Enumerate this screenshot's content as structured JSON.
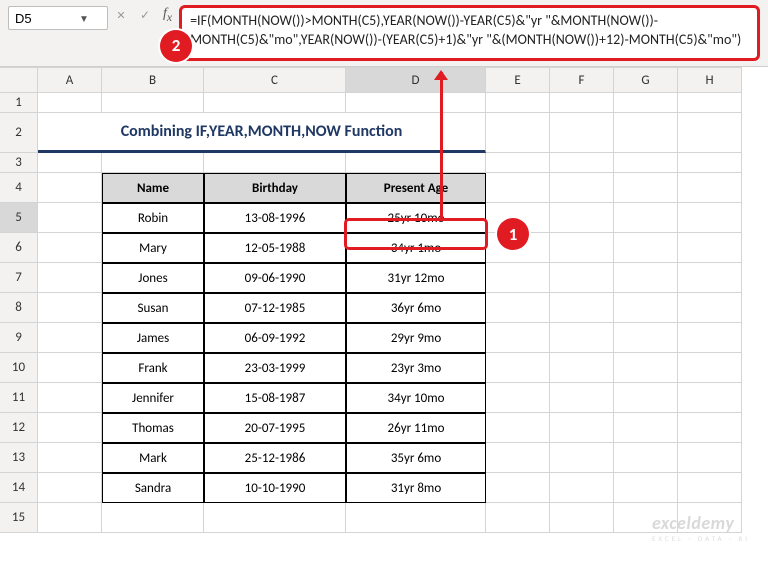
{
  "namebox": {
    "value": "D5"
  },
  "formula": "=IF(MONTH(NOW())>MONTH(C5),YEAR(NOW())-YEAR(C5)&\"yr \"&MONTH(NOW())-MONTH(C5)&\"mo\",YEAR(NOW())-(YEAR(C5)+1)&\"yr \"&(MONTH(NOW())+12)-MONTH(C5)&\"mo\")",
  "columns": [
    "A",
    "B",
    "C",
    "D",
    "E",
    "F",
    "G",
    "H"
  ],
  "rows": [
    "1",
    "2",
    "3",
    "4",
    "5",
    "6",
    "7",
    "8",
    "9",
    "10",
    "11",
    "12",
    "13",
    "14",
    "15"
  ],
  "title": "Combining IF,YEAR,MONTH,NOW Function",
  "headers": {
    "name": "Name",
    "birthday": "Birthday",
    "age": "Present Age"
  },
  "badges": {
    "one": "1",
    "two": "2"
  },
  "data": [
    {
      "name": "Robin",
      "birthday": "13-08-1996",
      "age": "25yr 10mo"
    },
    {
      "name": "Mary",
      "birthday": "12-05-1988",
      "age": "34yr 1mo"
    },
    {
      "name": "Jones",
      "birthday": "09-06-1990",
      "age": "31yr 12mo"
    },
    {
      "name": "Susan",
      "birthday": "07-12-1985",
      "age": "36yr 6mo"
    },
    {
      "name": "James",
      "birthday": "06-09-1992",
      "age": "29yr 9mo"
    },
    {
      "name": "Frank",
      "birthday": "23-03-1999",
      "age": "23yr 3mo"
    },
    {
      "name": "Jennifer",
      "birthday": "15-08-1987",
      "age": "34yr 10mo"
    },
    {
      "name": "Thomas",
      "birthday": "20-07-1995",
      "age": "26yr 11mo"
    },
    {
      "name": "Mark",
      "birthday": "25-12-1986",
      "age": "35yr 6mo"
    },
    {
      "name": "Sandra",
      "birthday": "10-10-1990",
      "age": "31yr 8mo"
    }
  ],
  "watermark": {
    "brand": "exceldemy",
    "tag": "EXCEL · DATA · BI"
  }
}
